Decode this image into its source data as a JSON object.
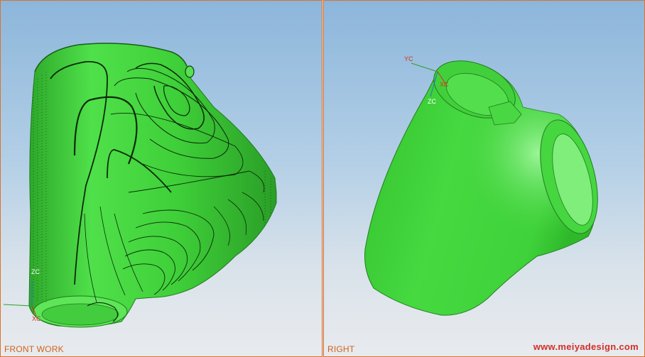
{
  "viewports": {
    "left": {
      "label": "FRONT WORK"
    },
    "right": {
      "label": "RIGHT"
    }
  },
  "axes": {
    "left": {
      "x_label": "XC",
      "z_label": "ZC"
    },
    "right": {
      "y_label": "YC",
      "z_label": "ZC",
      "x_label": "XC"
    }
  },
  "watermark": "www.meiyadesign.com",
  "colors": {
    "model": "#3fd33a",
    "accent_border": "#e0712a",
    "label": "#d0621d",
    "watermark": "#d0302a"
  }
}
